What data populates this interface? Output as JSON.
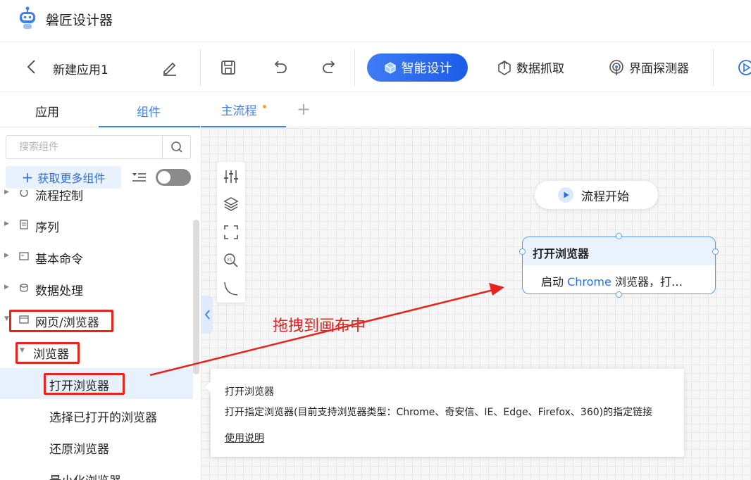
{
  "app": {
    "title": "磐匠设计器"
  },
  "toolbar": {
    "project_name": "新建应用1",
    "ai_design_label": "智能设计",
    "data_capture_label": "数据抓取",
    "ui_detector_label": "界面探测器"
  },
  "left_panel": {
    "tabs": [
      {
        "label": "应用"
      },
      {
        "label": "组件"
      }
    ],
    "active_tab": "组件",
    "search_placeholder": "搜索组件",
    "more_components_label": "获取更多组件",
    "tree": [
      {
        "label": "流程控制",
        "expanded": false
      },
      {
        "label": "序列",
        "expanded": false
      },
      {
        "label": "基本命令",
        "expanded": false
      },
      {
        "label": "数据处理",
        "expanded": false
      },
      {
        "label": "网页/浏览器",
        "expanded": true
      },
      {
        "label": "浏览器",
        "expanded": true
      },
      {
        "label": "打开浏览器",
        "selected": true
      },
      {
        "label": "选择已打开的浏览器"
      },
      {
        "label": "还原浏览器"
      },
      {
        "label": "最小化浏览器"
      }
    ]
  },
  "canvas": {
    "tabs": [
      {
        "label": "主流程",
        "unsaved": true
      }
    ],
    "start_node_label": "流程开始",
    "node": {
      "title": "打开浏览器",
      "desc_prefix": "启动 ",
      "desc_highlight": "Chrome",
      "desc_suffix": " 浏览器，打…"
    },
    "annotation": "拖拽到画布中"
  },
  "tooltip": {
    "title": "打开浏览器",
    "description": "打开指定浏览器(目前支持浏览器类型：Chrome、奇安信、IE、Edge、Firefox、360)的指定链接",
    "link": "使用说明"
  },
  "colors": {
    "accent": "#3d7ef0",
    "annotation_red": "#e8231e",
    "selected_bg": "#e6f1fc"
  }
}
